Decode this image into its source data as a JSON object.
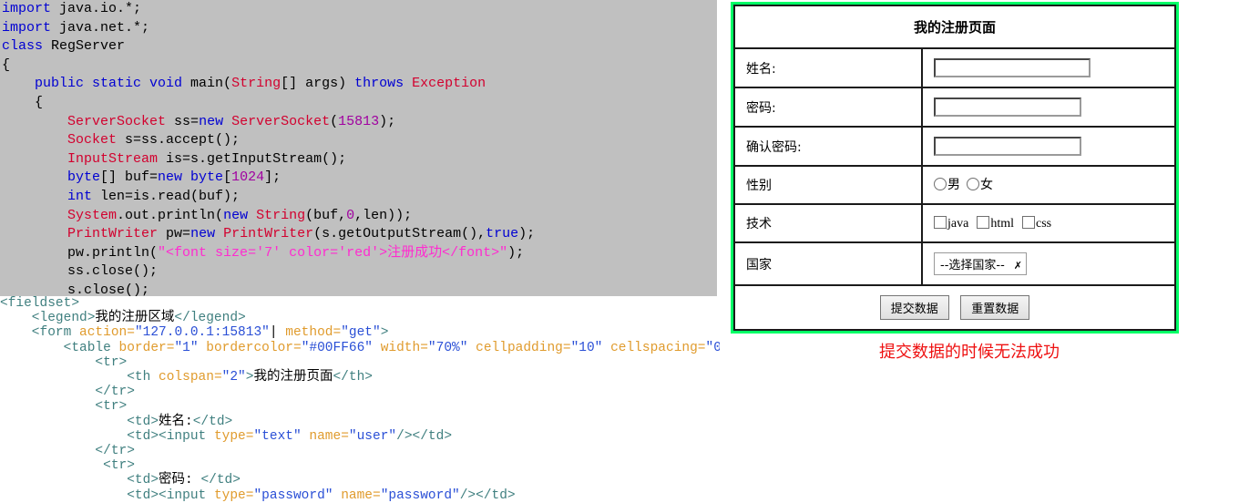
{
  "java_code": {
    "lines": [
      [
        {
          "t": "import ",
          "c": "kw"
        },
        {
          "t": "java.io.*;",
          "c": "plain"
        }
      ],
      [
        {
          "t": "import ",
          "c": "kw"
        },
        {
          "t": "java.net.*;",
          "c": "plain"
        }
      ],
      [
        {
          "t": "class ",
          "c": "kw"
        },
        {
          "t": "RegServer",
          "c": "plain"
        }
      ],
      [
        {
          "t": "{",
          "c": "plain"
        }
      ],
      [
        {
          "t": "    ",
          "c": "plain"
        },
        {
          "t": "public static void ",
          "c": "kw"
        },
        {
          "t": "main(",
          "c": "plain"
        },
        {
          "t": "String",
          "c": "typ"
        },
        {
          "t": "[] args) ",
          "c": "plain"
        },
        {
          "t": "throws ",
          "c": "kw"
        },
        {
          "t": "Exception",
          "c": "typ"
        }
      ],
      [
        {
          "t": "    {",
          "c": "plain"
        }
      ],
      [
        {
          "t": "        ",
          "c": "plain"
        },
        {
          "t": "ServerSocket",
          "c": "typ"
        },
        {
          "t": " ss=",
          "c": "plain"
        },
        {
          "t": "new",
          "c": "kw"
        },
        {
          "t": " ",
          "c": "plain"
        },
        {
          "t": "ServerSocket",
          "c": "typ"
        },
        {
          "t": "(",
          "c": "plain"
        },
        {
          "t": "15813",
          "c": "num"
        },
        {
          "t": ");",
          "c": "plain"
        }
      ],
      [
        {
          "t": "        ",
          "c": "plain"
        },
        {
          "t": "Socket",
          "c": "typ"
        },
        {
          "t": " s=ss.accept();",
          "c": "plain"
        }
      ],
      [
        {
          "t": "        ",
          "c": "plain"
        },
        {
          "t": "InputStream",
          "c": "typ"
        },
        {
          "t": " is=s.getInputStream();",
          "c": "plain"
        }
      ],
      [
        {
          "t": "        ",
          "c": "plain"
        },
        {
          "t": "byte",
          "c": "kw"
        },
        {
          "t": "[] buf=",
          "c": "plain"
        },
        {
          "t": "new byte",
          "c": "kw"
        },
        {
          "t": "[",
          "c": "plain"
        },
        {
          "t": "1024",
          "c": "num"
        },
        {
          "t": "];",
          "c": "plain"
        }
      ],
      [
        {
          "t": "        ",
          "c": "plain"
        },
        {
          "t": "int",
          "c": "kw"
        },
        {
          "t": " len=is.read(buf);",
          "c": "plain"
        }
      ],
      [
        {
          "t": "        ",
          "c": "plain"
        },
        {
          "t": "System",
          "c": "typ"
        },
        {
          "t": ".out.println(",
          "c": "plain"
        },
        {
          "t": "new",
          "c": "kw"
        },
        {
          "t": " ",
          "c": "plain"
        },
        {
          "t": "String",
          "c": "typ"
        },
        {
          "t": "(buf,",
          "c": "plain"
        },
        {
          "t": "0",
          "c": "num"
        },
        {
          "t": ",len));",
          "c": "plain"
        }
      ],
      [
        {
          "t": "        ",
          "c": "plain"
        },
        {
          "t": "PrintWriter",
          "c": "typ"
        },
        {
          "t": " pw=",
          "c": "plain"
        },
        {
          "t": "new",
          "c": "kw"
        },
        {
          "t": " ",
          "c": "plain"
        },
        {
          "t": "PrintWriter",
          "c": "typ"
        },
        {
          "t": "(s.getOutputStream(),",
          "c": "plain"
        },
        {
          "t": "true",
          "c": "kw"
        },
        {
          "t": ");",
          "c": "plain"
        }
      ],
      [
        {
          "t": "        ",
          "c": "plain"
        },
        {
          "t": "pw.println(",
          "c": "plain"
        },
        {
          "t": "\"<font size='7' color='red'>注册成功</font>\"",
          "c": "str"
        },
        {
          "t": ");",
          "c": "plain"
        }
      ],
      [
        {
          "t": "        ",
          "c": "plain"
        },
        {
          "t": "ss.close();",
          "c": "plain"
        }
      ],
      [
        {
          "t": "        ",
          "c": "plain"
        },
        {
          "t": "s.close();",
          "c": "plain"
        }
      ]
    ]
  },
  "html_code": {
    "lines": [
      [
        {
          "t": "<fieldset>",
          "c": "tag"
        }
      ],
      [
        {
          "t": "    <legend>",
          "c": "tag"
        },
        {
          "t": "我的注册区域",
          "c": "txt"
        },
        {
          "t": "</legend>",
          "c": "tag"
        }
      ],
      [
        {
          "t": "    <form ",
          "c": "tag"
        },
        {
          "t": "action=",
          "c": "attr"
        },
        {
          "t": "\"127.0.0.1:15813\"",
          "c": "val"
        },
        {
          "t": "| ",
          "c": "txt"
        },
        {
          "t": "method=",
          "c": "attr"
        },
        {
          "t": "\"get\"",
          "c": "val"
        },
        {
          "t": ">",
          "c": "tag"
        }
      ],
      [
        {
          "t": "        <table ",
          "c": "tag"
        },
        {
          "t": "border=",
          "c": "attr"
        },
        {
          "t": "\"1\" ",
          "c": "val"
        },
        {
          "t": "bordercolor=",
          "c": "attr"
        },
        {
          "t": "\"#00FF66\" ",
          "c": "val"
        },
        {
          "t": "width=",
          "c": "attr"
        },
        {
          "t": "\"70%\" ",
          "c": "val"
        },
        {
          "t": "cellpadding=",
          "c": "attr"
        },
        {
          "t": "\"10\" ",
          "c": "val"
        },
        {
          "t": "cellspacing=",
          "c": "attr"
        },
        {
          "t": "\"0\"",
          "c": "val"
        },
        {
          "t": ">",
          "c": "tag"
        }
      ],
      [
        {
          "t": "            <tr>",
          "c": "tag"
        }
      ],
      [
        {
          "t": "                <th ",
          "c": "tag"
        },
        {
          "t": "colspan=",
          "c": "attr"
        },
        {
          "t": "\"2\"",
          "c": "val"
        },
        {
          "t": ">",
          "c": "tag"
        },
        {
          "t": "我的注册页面",
          "c": "txt"
        },
        {
          "t": "</th>",
          "c": "tag"
        }
      ],
      [
        {
          "t": "            </tr>",
          "c": "tag"
        }
      ],
      [
        {
          "t": "            <tr>",
          "c": "tag"
        }
      ],
      [
        {
          "t": "                <td>",
          "c": "tag"
        },
        {
          "t": "姓名:",
          "c": "txt"
        },
        {
          "t": "</td>",
          "c": "tag"
        }
      ],
      [
        {
          "t": "                <td><input ",
          "c": "tag"
        },
        {
          "t": "type=",
          "c": "attr"
        },
        {
          "t": "\"text\" ",
          "c": "val"
        },
        {
          "t": "name=",
          "c": "attr"
        },
        {
          "t": "\"user\"",
          "c": "val"
        },
        {
          "t": "/></td>",
          "c": "tag"
        }
      ],
      [
        {
          "t": "            </tr>",
          "c": "tag"
        }
      ],
      [
        {
          "t": "             <tr>",
          "c": "tag"
        }
      ],
      [
        {
          "t": "                <td>",
          "c": "tag"
        },
        {
          "t": "密码: ",
          "c": "txt"
        },
        {
          "t": "</td>",
          "c": "tag"
        }
      ],
      [
        {
          "t": "                <td><input ",
          "c": "tag"
        },
        {
          "t": "type=",
          "c": "attr"
        },
        {
          "t": "\"password\" ",
          "c": "val"
        },
        {
          "t": "name=",
          "c": "attr"
        },
        {
          "t": "\"password\"",
          "c": "val"
        },
        {
          "t": "/></td>",
          "c": "tag"
        }
      ]
    ]
  },
  "reg_form": {
    "title": "我的注册页面",
    "rows": [
      {
        "label": "姓名:",
        "type": "text"
      },
      {
        "label": "密码:",
        "type": "text"
      },
      {
        "label": "确认密码:",
        "type": "text"
      },
      {
        "label": "性别",
        "type": "radio",
        "options": [
          "男",
          "女"
        ]
      },
      {
        "label": "技术",
        "type": "checkbox",
        "options": [
          "java",
          "html",
          "css"
        ]
      },
      {
        "label": "国家",
        "type": "select",
        "selected": "--选择国家--"
      }
    ],
    "submit_label": "提交数据",
    "reset_label": "重置数据",
    "border_color": "#00FF66"
  },
  "annotation": {
    "note": "提交数据的时候无法成功",
    "color": "#EE1111"
  }
}
